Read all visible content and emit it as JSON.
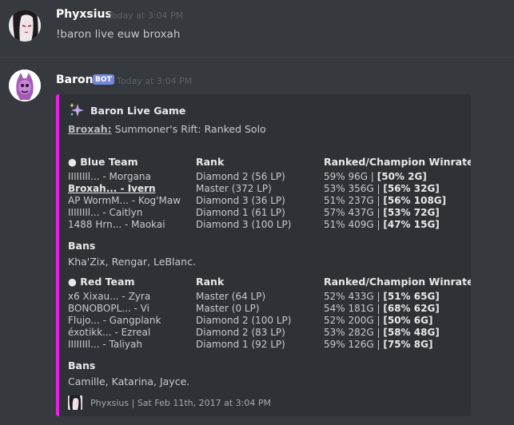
{
  "messages": [
    {
      "username": "Phyxsius",
      "timestamp": "Today at 3:04 PM",
      "text": "!baron live euw broxah"
    },
    {
      "username": "Baron",
      "badge": "BOT",
      "timestamp": "Today at 3:04 PM"
    }
  ],
  "embed": {
    "accent_color": "#e521e8",
    "author_icon": "sparkles-icon",
    "title": "Baron Live Game",
    "summoner_link": "Broxah:",
    "game_mode": " Summoner's Rift: Ranked Solo",
    "columns": {
      "team_bullet": "●",
      "rank": "Rank",
      "winrate": "Ranked/Champion Winrate"
    },
    "blue_team": {
      "name": "Blue Team",
      "players": [
        {
          "player": "IIIIIIIl... - Morgana",
          "rank": "Diamond 2 (56 LP)",
          "winrate": "59% 96G | ",
          "champ": "[50% 2G]"
        },
        {
          "player": "Broxah... - Ivern",
          "rank": "Master (372 LP)",
          "winrate": "53% 356G | ",
          "champ": "[56% 32G]"
        },
        {
          "player": "AP WormM... - Kog'Maw",
          "rank": "Diamond 3 (36 LP)",
          "winrate": "51% 237G | ",
          "champ": "[56% 108G]"
        },
        {
          "player": "IIIIIIIl... - Caitlyn",
          "rank": "Diamond 1 (61 LP)",
          "winrate": "57% 437G | ",
          "champ": "[53% 72G]"
        },
        {
          "player": "1488 Hrn... - Maokai",
          "rank": "Diamond 3 (100 LP)",
          "winrate": "51% 409G | ",
          "champ": "[47% 15G]"
        }
      ],
      "bans_label": "Bans",
      "bans": "Kha'Zix, Rengar, LeBlanc."
    },
    "red_team": {
      "name": "Red Team",
      "players": [
        {
          "player": "x6 Xixau... - Zyra",
          "rank": "Master (64 LP)",
          "winrate": "52% 433G | ",
          "champ": "[51% 65G]"
        },
        {
          "player": "BONOBOPL... - Vi",
          "rank": "Master (0 LP)",
          "winrate": "54% 181G | ",
          "champ": "[68% 62G]"
        },
        {
          "player": "Flujo... - Gangplank",
          "rank": "Diamond 2 (100 LP)",
          "winrate": "52% 200G | ",
          "champ": "[50% 6G]"
        },
        {
          "player": "éxotikk... - Ezreal",
          "rank": "Diamond 2 (83 LP)",
          "winrate": "53% 282G | ",
          "champ": "[58% 48G]"
        },
        {
          "player": "IIIIIIIl... - Taliyah",
          "rank": "Diamond 1 (92 LP)",
          "winrate": "59% 126G | ",
          "champ": "[75% 8G]"
        }
      ],
      "bans_label": "Bans",
      "bans": "Camille, Katarina, Jayce."
    },
    "footer": "Phyxsius | Sat Feb 11th, 2017 at 3:04 PM"
  }
}
